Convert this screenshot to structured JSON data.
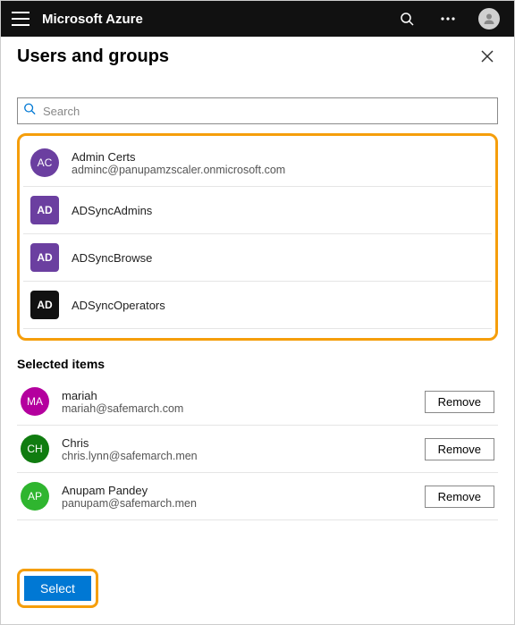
{
  "topbar": {
    "brand": "Microsoft Azure"
  },
  "header": {
    "title": "Users and groups"
  },
  "search": {
    "placeholder": "Search"
  },
  "available": {
    "items": [
      {
        "initials": "AC",
        "name": "Admin Certs",
        "sub": "adminc@panupamzscaler.onmicrosoft.com",
        "color": "#6b3fa0",
        "shape": "circle"
      },
      {
        "initials": "AD",
        "name": "ADSyncAdmins",
        "sub": "",
        "color": "#6b3fa0",
        "shape": "square"
      },
      {
        "initials": "AD",
        "name": "ADSyncBrowse",
        "sub": "",
        "color": "#6b3fa0",
        "shape": "square"
      },
      {
        "initials": "AD",
        "name": "ADSyncOperators",
        "sub": "",
        "color": "#111111",
        "shape": "square"
      }
    ]
  },
  "selected": {
    "title": "Selected items",
    "remove_label": "Remove",
    "items": [
      {
        "initials": "MA",
        "name": "mariah",
        "sub": "mariah@safemarch.com",
        "color": "#b4009e"
      },
      {
        "initials": "CH",
        "name": "Chris",
        "sub": "chris.lynn@safemarch.men",
        "color": "#107c10"
      },
      {
        "initials": "AP",
        "name": "Anupam Pandey",
        "sub": "panupam@safemarch.men",
        "color": "#2fb52f"
      }
    ]
  },
  "footer": {
    "select_label": "Select"
  }
}
